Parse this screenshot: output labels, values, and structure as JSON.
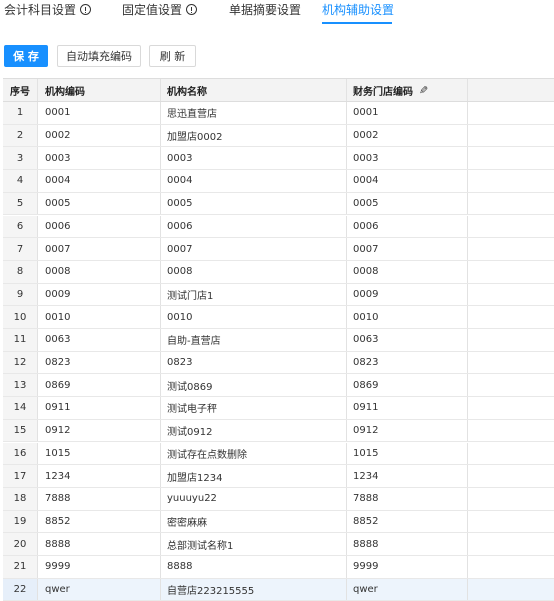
{
  "tabs": [
    {
      "label": "会计科目设置",
      "has_info": true
    },
    {
      "label": "固定值设置",
      "has_info": true
    },
    {
      "label": "单据摘要设置",
      "has_info": false
    },
    {
      "label": "机构辅助设置",
      "has_info": false,
      "active": true
    }
  ],
  "toolbar": {
    "save_label": "保 存",
    "autofill_label": "自动填充编码",
    "refresh_label": "刷 新"
  },
  "table": {
    "headers": {
      "seq": "序号",
      "code": "机构编码",
      "name": "机构名称",
      "fin_code": "财务门店编码"
    },
    "rows": [
      {
        "seq": "1",
        "code": "0001",
        "name": "思迅直营店",
        "fin": "0001"
      },
      {
        "seq": "2",
        "code": "0002",
        "name": "加盟店0002",
        "fin": "0002"
      },
      {
        "seq": "3",
        "code": "0003",
        "name": "0003",
        "fin": "0003"
      },
      {
        "seq": "4",
        "code": "0004",
        "name": "0004",
        "fin": "0004"
      },
      {
        "seq": "5",
        "code": "0005",
        "name": "0005",
        "fin": "0005"
      },
      {
        "seq": "6",
        "code": "0006",
        "name": "0006",
        "fin": "0006"
      },
      {
        "seq": "7",
        "code": "0007",
        "name": "0007",
        "fin": "0007"
      },
      {
        "seq": "8",
        "code": "0008",
        "name": "0008",
        "fin": "0008"
      },
      {
        "seq": "9",
        "code": "0009",
        "name": "测试门店1",
        "fin": "0009"
      },
      {
        "seq": "10",
        "code": "0010",
        "name": "0010",
        "fin": "0010"
      },
      {
        "seq": "11",
        "code": "0063",
        "name": "自助-直营店",
        "fin": "0063"
      },
      {
        "seq": "12",
        "code": "0823",
        "name": "0823",
        "fin": "0823"
      },
      {
        "seq": "13",
        "code": "0869",
        "name": "测试0869",
        "fin": "0869"
      },
      {
        "seq": "14",
        "code": "0911",
        "name": "测试电子秤",
        "fin": "0911"
      },
      {
        "seq": "15",
        "code": "0912",
        "name": "测试0912",
        "fin": "0912"
      },
      {
        "seq": "16",
        "code": "1015",
        "name": "测试存在点数删除",
        "fin": "1015"
      },
      {
        "seq": "17",
        "code": "1234",
        "name": "加盟店1234",
        "fin": "1234"
      },
      {
        "seq": "18",
        "code": "7888",
        "name": "yuuuyu22",
        "fin": "7888"
      },
      {
        "seq": "19",
        "code": "8852",
        "name": "密密麻麻",
        "fin": "8852"
      },
      {
        "seq": "20",
        "code": "8888",
        "name": "总部测试名称1",
        "fin": "8888"
      },
      {
        "seq": "21",
        "code": "9999",
        "name": "8888",
        "fin": "9999"
      },
      {
        "seq": "22",
        "code": "qwer",
        "name": "自营店223215555",
        "fin": "qwer",
        "selected": true
      }
    ]
  },
  "colors": {
    "accent": "#1890ff",
    "header_bg": "#f3f3f3",
    "selected_row": "#edf4fc"
  }
}
